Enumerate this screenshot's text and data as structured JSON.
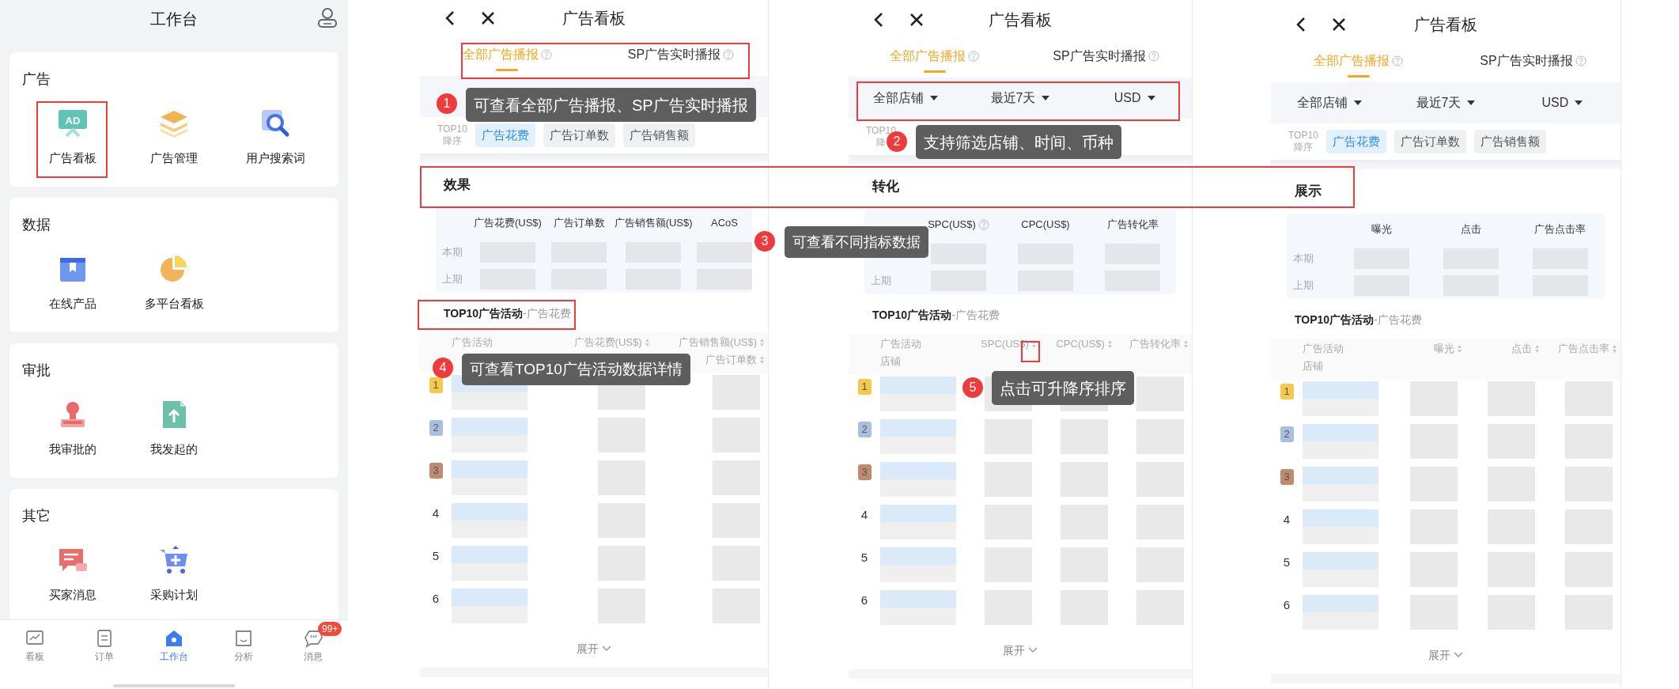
{
  "workbench": {
    "title": "工作台",
    "sections": [
      {
        "title": "广告",
        "items": [
          {
            "label": "广告看板",
            "icon_text": "AD"
          },
          {
            "label": "广告管理"
          },
          {
            "label": "用户搜索词"
          }
        ]
      },
      {
        "title": "数据",
        "items": [
          {
            "label": "在线产品"
          },
          {
            "label": "多平台看板"
          }
        ]
      },
      {
        "title": "审批",
        "items": [
          {
            "label": "我审批的"
          },
          {
            "label": "我发起的"
          }
        ]
      },
      {
        "title": "其它",
        "items": [
          {
            "label": "买家消息"
          },
          {
            "label": "采购计划"
          }
        ]
      }
    ],
    "tab_bar": [
      {
        "label": "看板",
        "selected": false
      },
      {
        "label": "订单",
        "selected": false
      },
      {
        "label": "工作台",
        "selected": true
      },
      {
        "label": "分析",
        "selected": false
      },
      {
        "label": "消息",
        "selected": false,
        "badge": "99+"
      }
    ]
  },
  "screens": [
    {
      "title": "广告看板",
      "tabs": [
        {
          "label": "全部广告播报",
          "selected": true
        },
        {
          "label": "SP广告实时播报",
          "selected": false
        }
      ],
      "sort_caption": "TOP10",
      "sort_order": "降序",
      "chips": [
        {
          "label": "广告花费",
          "selected": true
        },
        {
          "label": "广告订单数",
          "selected": false
        },
        {
          "label": "广告销售额",
          "selected": false
        }
      ],
      "section": "效果",
      "metrics": {
        "columns": [
          {
            "label": "广告花费(US$)"
          },
          {
            "label": "广告订单数"
          },
          {
            "label": "广告销售额(US$)"
          },
          {
            "label": "ACoS"
          }
        ],
        "periods": [
          "本期",
          "上期"
        ]
      },
      "top10": {
        "title": "TOP10广告活动",
        "metric": "-广告花费"
      },
      "table": {
        "columns": [
          {
            "label": "广告活动",
            "sortable": false
          },
          {
            "label": "广告花费(US$)",
            "sortable": true
          },
          {
            "label": "广告销售额(US$)",
            "sortable": true,
            "sub": "广告订单数",
            "sub_sortable": true
          }
        ],
        "ranks": [
          {
            "rank": "1",
            "color": "#f6c94c"
          },
          {
            "rank": "2",
            "color": "#a9bfe0"
          },
          {
            "rank": "3",
            "color": "#bf8a70"
          },
          {
            "rank": "4"
          },
          {
            "rank": "5"
          },
          {
            "rank": "6"
          }
        ]
      },
      "expand": "展开"
    },
    {
      "title": "广告看板",
      "tabs": [
        {
          "label": "全部广告播报",
          "selected": true
        },
        {
          "label": "SP广告实时播报",
          "selected": false
        }
      ],
      "filters": [
        "全部店铺",
        "最近7天",
        "USD"
      ],
      "sort_caption": "TOP10",
      "sort_order": "降",
      "section": "转化",
      "metrics": {
        "columns": [
          {
            "label": "SPC(US$)",
            "help": true
          },
          {
            "label": "CPC(US$)"
          },
          {
            "label": "广告转化率"
          }
        ],
        "periods": [
          "上期"
        ]
      },
      "top10": {
        "title": "TOP10广告活动",
        "metric": "-广告花费"
      },
      "table": {
        "columns": [
          {
            "label": "广告活动",
            "sortable": false,
            "sub": "店铺",
            "sub_sortable": false
          },
          {
            "label": "SPC(US$)",
            "sortable": true
          },
          {
            "label": "CPC(US$)",
            "sortable": true
          },
          {
            "label": "广告转化率",
            "sortable": true
          }
        ],
        "ranks": [
          {
            "rank": "1",
            "color": "#f6c94c"
          },
          {
            "rank": "2",
            "color": "#a9bfe0"
          },
          {
            "rank": "3",
            "color": "#bf8a70"
          },
          {
            "rank": "4"
          },
          {
            "rank": "5"
          },
          {
            "rank": "6"
          }
        ]
      },
      "expand": "展开"
    },
    {
      "title": "广告看板",
      "tabs": [
        {
          "label": "全部广告播报",
          "selected": true
        },
        {
          "label": "SP广告实时播报",
          "selected": false
        }
      ],
      "filters": [
        "全部店铺",
        "最近7天",
        "USD"
      ],
      "sort_caption": "TOP10",
      "sort_order": "降序",
      "chips": [
        {
          "label": "广告花费",
          "selected": true
        },
        {
          "label": "广告订单数",
          "selected": false
        },
        {
          "label": "广告销售额",
          "selected": false
        }
      ],
      "section": "展示",
      "metrics": {
        "columns": [
          {
            "label": "曝光"
          },
          {
            "label": "点击"
          },
          {
            "label": "广告点击率"
          }
        ],
        "periods": [
          "本期",
          "上期"
        ]
      },
      "top10": {
        "title": "TOP10广告活动",
        "metric": "-广告花费"
      },
      "table": {
        "columns": [
          {
            "label": "广告活动",
            "sortable": false,
            "sub": "店铺",
            "sub_sortable": false
          },
          {
            "label": "曝光",
            "sortable": true
          },
          {
            "label": "点击",
            "sortable": true
          },
          {
            "label": "广告点击率",
            "sortable": true
          }
        ],
        "ranks": [
          {
            "rank": "1",
            "color": "#f6c94c"
          },
          {
            "rank": "2",
            "color": "#a9bfe0"
          },
          {
            "rank": "3",
            "color": "#bf8a70"
          },
          {
            "rank": "4"
          },
          {
            "rank": "5"
          },
          {
            "rank": "6"
          }
        ]
      },
      "expand": "展开"
    }
  ],
  "callouts": [
    {
      "number": "1",
      "text": "可查看全部广告播报、SP广告实时播报"
    },
    {
      "number": "2",
      "text": "支持筛选店铺、时间、币种"
    },
    {
      "number": "3",
      "text": "可查看不同指标数据"
    },
    {
      "number": "4",
      "text": "可查看TOP10广告活动数据详情"
    },
    {
      "number": "5",
      "text": "点击可升降序排序"
    }
  ]
}
